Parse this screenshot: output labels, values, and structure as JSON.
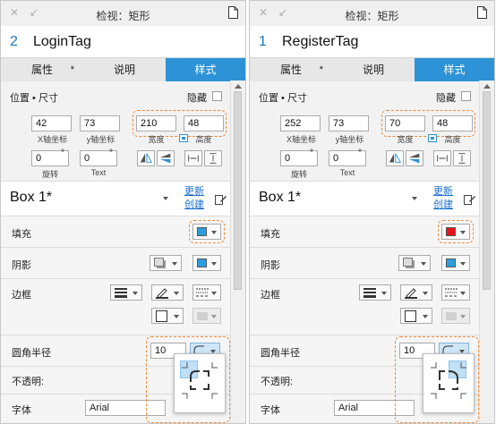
{
  "panels": [
    {
      "title": "检视：矩形",
      "widget_number": "2",
      "widget_name": "LoginTag",
      "tabs": [
        {
          "label": "属性"
        },
        {
          "label": "说明"
        },
        {
          "label": "样式"
        }
      ],
      "tab_star": "*",
      "position_label": "位置 • 尺寸",
      "hide_label": "隐藏",
      "x_value": "42",
      "x_label": "X轴坐标",
      "y_value": "73",
      "y_label": "y轴坐标",
      "w_value": "210",
      "w_label": "宽度",
      "h_value": "48",
      "h_label": "高度",
      "rotate_value": "0",
      "rotate_label": "旋转",
      "text_rotate_value": "0",
      "text_rotate_label": "Text",
      "degree": "°",
      "box_style": "Box 1*",
      "link_update": "更新",
      "link_create": "创建",
      "fill_label": "填充",
      "fill_color": "#2a9fe0",
      "shadow_label": "阴影",
      "border_label": "边框",
      "radius_label": "圆角半径",
      "radius_value": "10",
      "opacity_label": "不透明:",
      "font_label": "字体",
      "font_value": "Arial",
      "popup_selected": "top-left"
    },
    {
      "title": "检视：矩形",
      "widget_number": "1",
      "widget_name": "RegisterTag",
      "tabs": [
        {
          "label": "属性"
        },
        {
          "label": "说明"
        },
        {
          "label": "样式"
        }
      ],
      "tab_star": "*",
      "position_label": "位置 • 尺寸",
      "hide_label": "隐藏",
      "x_value": "252",
      "x_label": "X轴坐标",
      "y_value": "73",
      "y_label": "y轴坐标",
      "w_value": "70",
      "w_label": "宽度",
      "h_value": "48",
      "h_label": "高度",
      "rotate_value": "0",
      "rotate_label": "旋转",
      "text_rotate_value": "0",
      "text_rotate_label": "Text",
      "degree": "°",
      "box_style": "Box 1*",
      "link_update": "更新",
      "link_create": "创建",
      "fill_label": "填充",
      "fill_color": "#e8141a",
      "shadow_label": "阴影",
      "border_label": "边框",
      "radius_label": "圆角半径",
      "radius_value": "10",
      "opacity_label": "不透明:",
      "font_label": "字体",
      "font_value": "Arial",
      "popup_selected": "top-right"
    }
  ],
  "colors": {
    "accent": "#2d93d6",
    "highlight_dash": "#ee8a3a",
    "shadow_swatch": "#2a9fe0"
  }
}
